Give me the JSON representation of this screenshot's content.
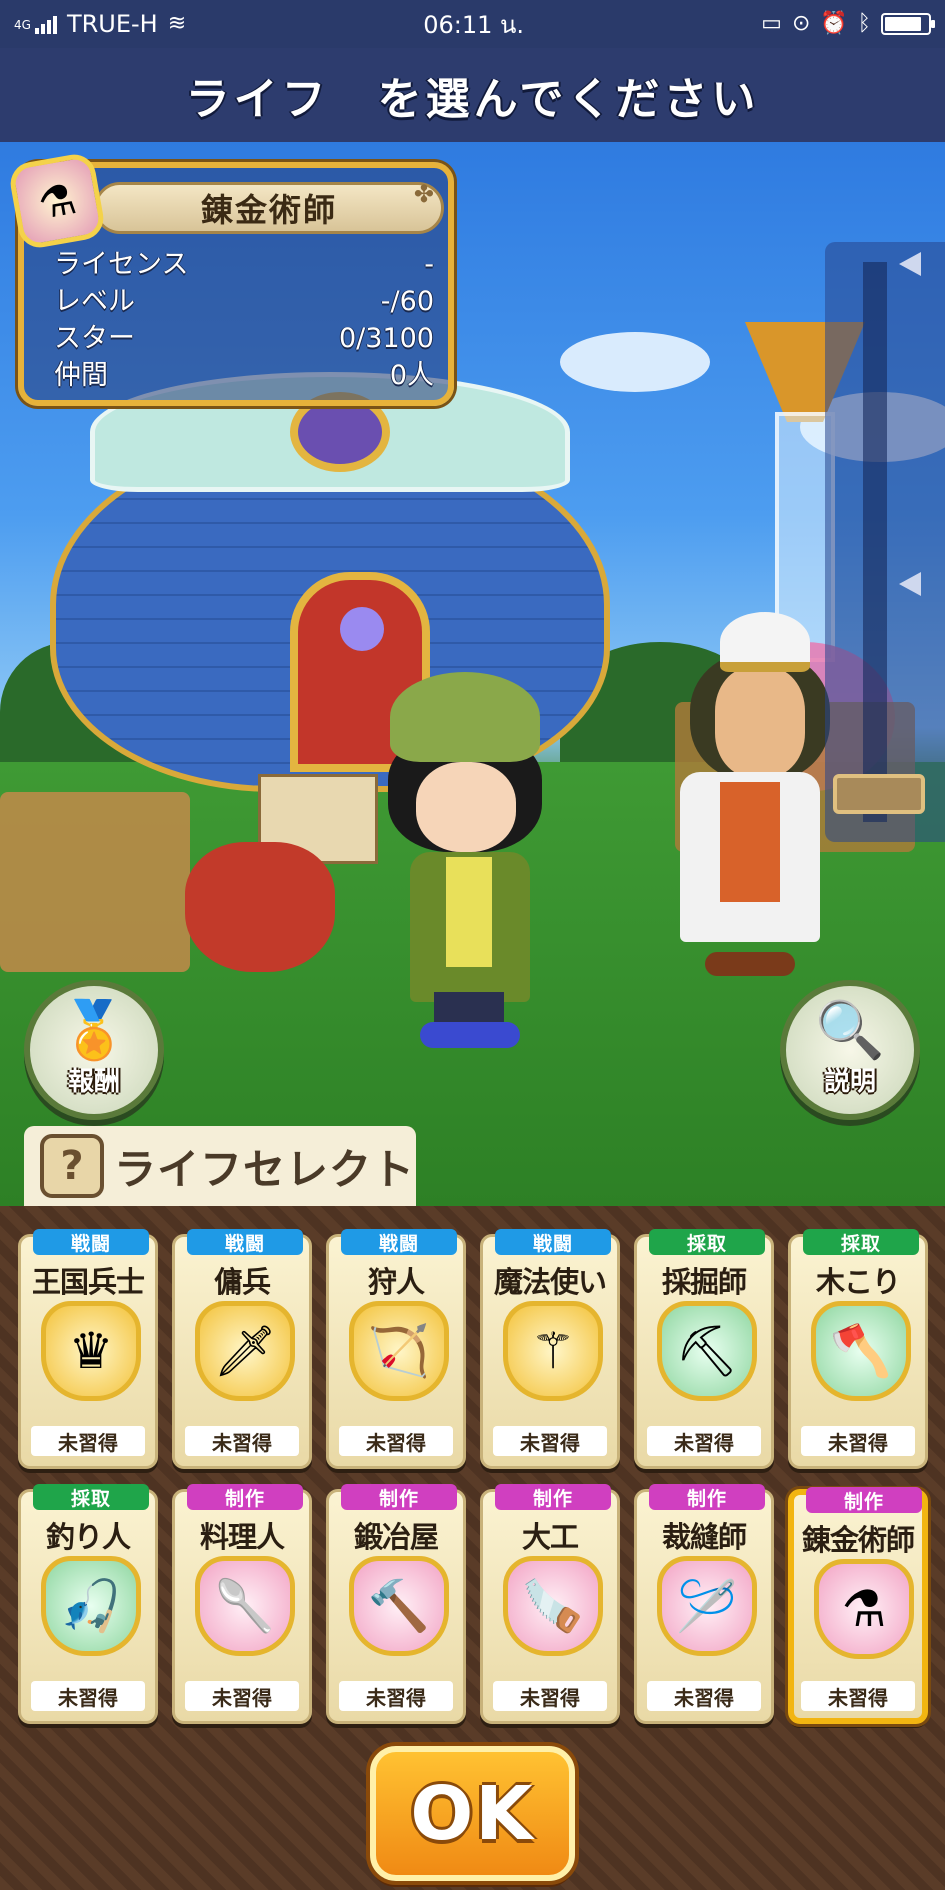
{
  "status_bar": {
    "network_type": "4G",
    "carrier": "TRUE-H",
    "time": "06:11 น.",
    "battery_level": 0.85,
    "icons": [
      "signal-icon",
      "wifi-icon",
      "cast-icon",
      "lock-rotation-icon",
      "alarm-icon",
      "bluetooth-icon",
      "battery-icon"
    ]
  },
  "header": {
    "title": "ライフ　を選んでください"
  },
  "info_panel": {
    "title": "錬金術師",
    "icon": "flask-icon",
    "rows": [
      {
        "label": "ライセンス",
        "value": "-"
      },
      {
        "label": "レベル",
        "value": "-/60"
      },
      {
        "label": "スター",
        "value": "0/3100"
      },
      {
        "label": "仲間",
        "value": "0人"
      }
    ]
  },
  "buttons": {
    "reward": {
      "label": "報酬",
      "icon": "star-medal-icon"
    },
    "help": {
      "label": "説明",
      "icon": "magnifier-icon"
    },
    "ok": {
      "label": "OK"
    }
  },
  "life_select": {
    "label": "ライフセレクト",
    "icon": "question-icon"
  },
  "jobs": [
    {
      "category": "戦闘",
      "name": "王国兵士",
      "status": "未習得",
      "icon": "crown-shield-icon",
      "cat": "battle"
    },
    {
      "category": "戦闘",
      "name": "傭兵",
      "status": "未習得",
      "icon": "sword-icon",
      "cat": "battle"
    },
    {
      "category": "戦闘",
      "name": "狩人",
      "status": "未習得",
      "icon": "bow-icon",
      "cat": "battle"
    },
    {
      "category": "戦闘",
      "name": "魔法使い",
      "status": "未習得",
      "icon": "magic-wand-icon",
      "cat": "battle"
    },
    {
      "category": "採取",
      "name": "採掘師",
      "status": "未習得",
      "icon": "pickaxe-icon",
      "cat": "gather"
    },
    {
      "category": "採取",
      "name": "木こり",
      "status": "未習得",
      "icon": "axe-icon",
      "cat": "gather"
    },
    {
      "category": "採取",
      "name": "釣り人",
      "status": "未習得",
      "icon": "fishing-rod-icon",
      "cat": "gather"
    },
    {
      "category": "制作",
      "name": "料理人",
      "status": "未習得",
      "icon": "ladle-icon",
      "cat": "craft"
    },
    {
      "category": "制作",
      "name": "鍛冶屋",
      "status": "未習得",
      "icon": "hammer-icon",
      "cat": "craft"
    },
    {
      "category": "制作",
      "name": "大工",
      "status": "未習得",
      "icon": "saw-icon",
      "cat": "craft"
    },
    {
      "category": "制作",
      "name": "裁縫師",
      "status": "未習得",
      "icon": "needle-icon",
      "cat": "craft"
    },
    {
      "category": "制作",
      "name": "錬金術師",
      "status": "未習得",
      "icon": "flask-icon",
      "cat": "craft",
      "selected": true
    }
  ],
  "colors": {
    "battle": "#1f9ae6",
    "gather": "#1fa54a",
    "craft": "#d03fc0",
    "ok": "#f08a14",
    "selected_border": "#f2b511"
  }
}
